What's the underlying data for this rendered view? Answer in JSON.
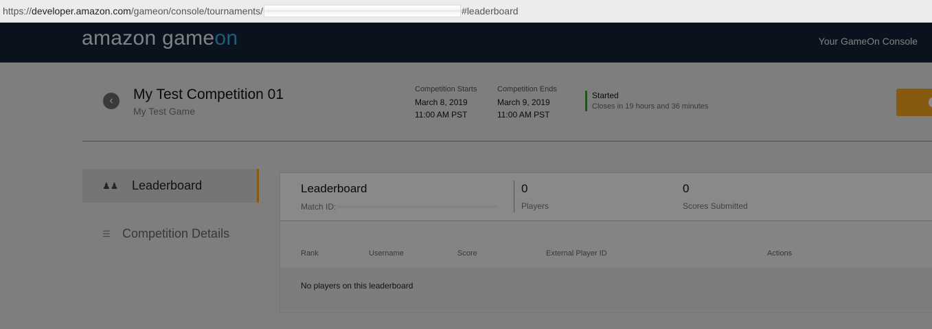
{
  "browser": {
    "url_prefix": "https://",
    "url_domain": "developer.amazon.com",
    "url_path": "/gameon/console/tournaments/",
    "url_hash": "#leaderboard"
  },
  "header": {
    "logo_main": "amazon game",
    "logo_accent": "on",
    "console_link": "Your GameOn Console"
  },
  "competition": {
    "title": "My Test Competition 01",
    "game": "My Test Game",
    "starts_label": "Competition Starts",
    "starts_date": "March 8, 2019",
    "starts_time": "11:00 AM PST",
    "ends_label": "Competition Ends",
    "ends_date": "March 9, 2019",
    "ends_time": "11:00 AM PST",
    "status": "Started",
    "closes": "Closes in 19 hours and 36 minutes"
  },
  "sidebar": {
    "items": [
      {
        "label": "Leaderboard",
        "icon": "players-icon"
      },
      {
        "label": "Competition Details",
        "icon": "list-icon"
      }
    ]
  },
  "leaderboard": {
    "title": "Leaderboard",
    "match_id_label": "Match ID:",
    "players_count": "0",
    "players_label": "Players",
    "scores_count": "0",
    "scores_label": "Scores Submitted",
    "columns": [
      "Rank",
      "Username",
      "Score",
      "External Player ID",
      "Actions"
    ],
    "empty_message": "No players on this leaderboard"
  },
  "colors": {
    "header_bg": "#132235",
    "accent_orange": "#f4a41c",
    "status_green": "#3f9c35",
    "logo_blue": "#3aa9e6"
  }
}
